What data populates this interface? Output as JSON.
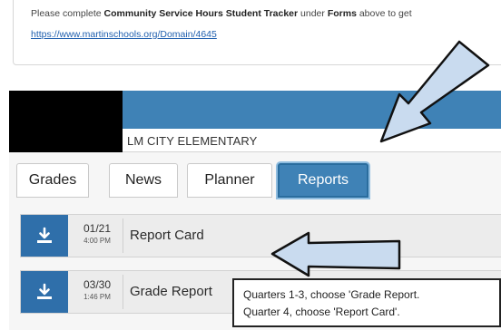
{
  "notice": {
    "text_prefix": "Please complete ",
    "text_bold1": "Community Service Hours Student Tracker",
    "text_mid": " under ",
    "text_bold2": "Forms",
    "text_suffix": " above to get",
    "link": "https://www.martinschools.org/Domain/4645"
  },
  "school": {
    "name": "LM CITY ELEMENTARY"
  },
  "tabs": [
    {
      "label": "Grades",
      "active": false
    },
    {
      "label": "News",
      "active": false
    },
    {
      "label": "Planner",
      "active": false
    },
    {
      "label": "Reports",
      "active": true
    }
  ],
  "reports": [
    {
      "date": "01/21",
      "time": "4:00 PM",
      "title": "Report Card"
    },
    {
      "date": "03/30",
      "time": "1:46 PM",
      "title": "Grade Report"
    }
  ],
  "callout": {
    "line1": "Quarters 1-3, choose 'Grade Report.",
    "line2": "Quarter 4, choose 'Report Card'."
  },
  "colors": {
    "accent": "#3f82b6",
    "button": "#2f6faa",
    "arrow_fill": "#c9dbef"
  }
}
